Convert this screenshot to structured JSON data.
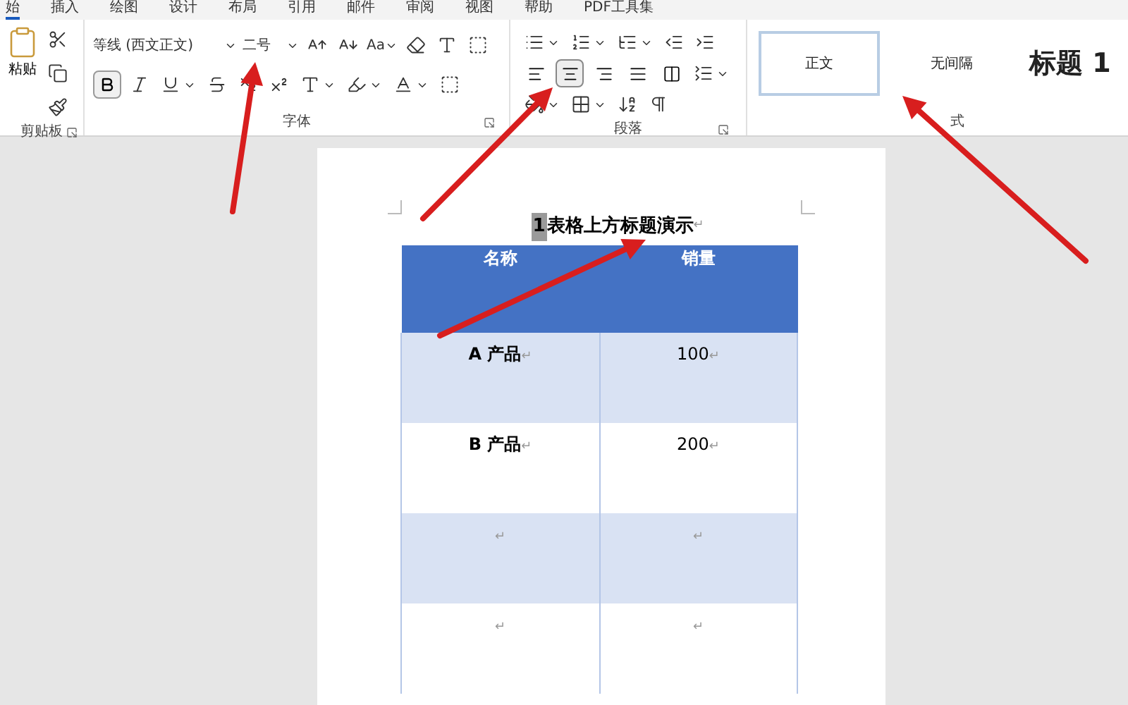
{
  "menu_tabs": [
    {
      "label": "始",
      "selected": true
    },
    {
      "label": "插入",
      "selected": false
    },
    {
      "label": "绘图",
      "selected": false
    },
    {
      "label": "设计",
      "selected": false
    },
    {
      "label": "布局",
      "selected": false
    },
    {
      "label": "引用",
      "selected": false
    },
    {
      "label": "邮件",
      "selected": false
    },
    {
      "label": "审阅",
      "selected": false
    },
    {
      "label": "视图",
      "selected": false
    },
    {
      "label": "帮助",
      "selected": false
    },
    {
      "label": "PDF工具集",
      "selected": false
    }
  ],
  "clipboard": {
    "paste": "粘贴",
    "label": "剪贴板"
  },
  "font": {
    "name": "等线 (西文正文)",
    "size": "二号",
    "case_button": "Aa",
    "bold_selected": true,
    "label": "字体"
  },
  "paragraph": {
    "alignments": [
      {
        "kind": "left",
        "selected": false
      },
      {
        "kind": "center",
        "selected": true
      },
      {
        "kind": "right",
        "selected": false
      },
      {
        "kind": "justify",
        "selected": false
      },
      {
        "kind": "distributed",
        "selected": false
      }
    ],
    "label": "段落"
  },
  "styles": {
    "items": [
      {
        "label": "正文",
        "kind": "normal",
        "selected": true
      },
      {
        "label": "无间隔",
        "kind": "normal",
        "selected": false
      },
      {
        "label": "标题 1",
        "kind": "heading",
        "selected": false
      }
    ],
    "label": "式"
  },
  "document": {
    "caption": {
      "number": "1",
      "text": "表格上方标题演示",
      "mark": "↵"
    },
    "table": {
      "columns": [
        "名称",
        "销量"
      ],
      "rows": [
        {
          "cells": [
            {
              "text": "A 产品",
              "mark": "↵"
            },
            {
              "text": "100",
              "mark": "↵"
            }
          ]
        },
        {
          "cells": [
            {
              "text": "B 产品",
              "mark": "↵"
            },
            {
              "text": "200",
              "mark": "↵"
            }
          ]
        },
        {
          "cells": [
            {
              "mark": "↵"
            },
            {
              "mark": "↵"
            }
          ]
        },
        {
          "cells": [
            {
              "mark": "↵"
            },
            {
              "mark": "↵"
            }
          ]
        }
      ]
    }
  }
}
